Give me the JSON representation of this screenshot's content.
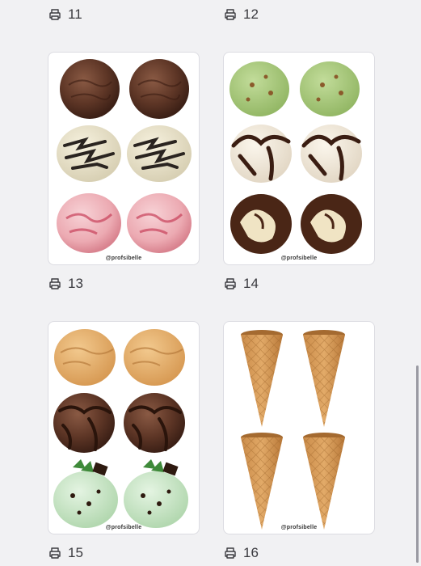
{
  "labels": {
    "p11": "11",
    "p12": "12",
    "p13": "13",
    "p14": "14",
    "p15": "15",
    "p16": "16"
  },
  "cards": {
    "c13": {
      "credit": "@profsibelle",
      "content": "chocolate, cookies and cream, strawberry ice cream scoops"
    },
    "c14": {
      "credit": "@profsibelle",
      "content": "pistachio, vanilla fudge, chocolate swirl ice cream scoops"
    },
    "c15": {
      "credit": "@profsibelle",
      "content": "caramel, chocolate fudge, mint chocolate chip ice cream scoops"
    },
    "c16": {
      "credit": "@profsibelle",
      "content": "waffle ice cream cones"
    }
  },
  "colors": {
    "background": "#f1f1f3",
    "card": "#ffffff",
    "text": "#3a3a3f"
  },
  "icons": {
    "print": "printer-icon"
  }
}
